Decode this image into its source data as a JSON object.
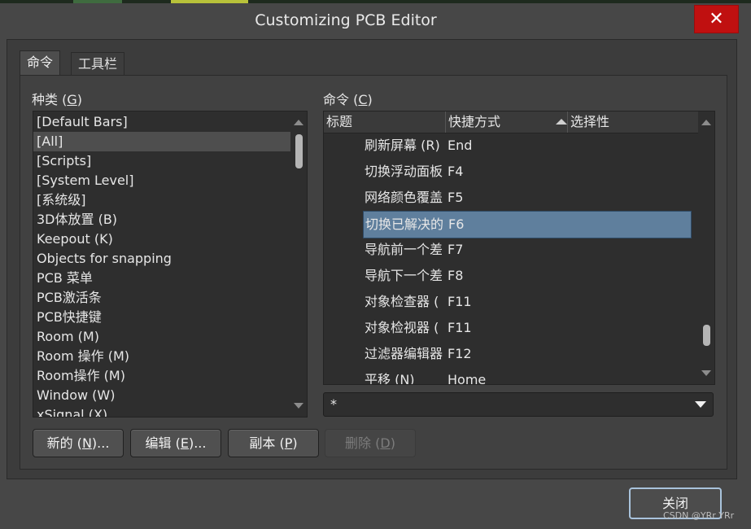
{
  "window": {
    "title": "Customizing PCB Editor",
    "close_glyph": "✕"
  },
  "tabs": [
    {
      "label": "命令"
    },
    {
      "label": "工具栏"
    }
  ],
  "categories": {
    "label_text": "种类 (",
    "label_key": "G",
    "label_end": ")",
    "items": [
      "[Default Bars]",
      "[All]",
      "[Scripts]",
      "[System Level]",
      "[系统级]",
      "3D体放置 (B)",
      "Keepout (K)",
      "Objects for snapping",
      "PCB 菜单",
      "PCB激活条",
      "PCB快捷键",
      "Room (M)",
      "Room 操作 (M)",
      "Room操作 (M)",
      "Window (W)",
      "xSignal (X)"
    ],
    "selected_index": 1
  },
  "commands": {
    "label_text": "命令 (",
    "label_key": "C",
    "label_end": ")",
    "columns": [
      "标题",
      "快捷方式",
      "选择性"
    ],
    "rows": [
      {
        "title": "刷新屏幕 (R)",
        "shortcut": "End"
      },
      {
        "title": "切换浮动面板",
        "shortcut": "F4"
      },
      {
        "title": "网络颜色覆盖",
        "shortcut": "F5"
      },
      {
        "title": "切换已解决的",
        "shortcut": "F6"
      },
      {
        "title": "导航前一个差",
        "shortcut": "F7"
      },
      {
        "title": "导航下一个差",
        "shortcut": "F8"
      },
      {
        "title": "对象检查器 (",
        "shortcut": "F11"
      },
      {
        "title": "对象检视器 (",
        "shortcut": "F11"
      },
      {
        "title": "过滤器编辑器",
        "shortcut": "F12"
      },
      {
        "title": "平移 (N)",
        "shortcut": "Home"
      }
    ],
    "selected_index": 3
  },
  "filter": {
    "value": "*"
  },
  "buttons": {
    "new": {
      "text": "新的 (",
      "key": "N",
      "end": ")..."
    },
    "edit": {
      "text": "编辑 (",
      "key": "E",
      "end": ")..."
    },
    "copy": {
      "text": "副本 (",
      "key": "P",
      "end": ")"
    },
    "delete": {
      "text": "删除 (",
      "key": "D",
      "end": ")"
    },
    "close": "关闭"
  },
  "watermark": "CSDN @YRr YRr"
}
